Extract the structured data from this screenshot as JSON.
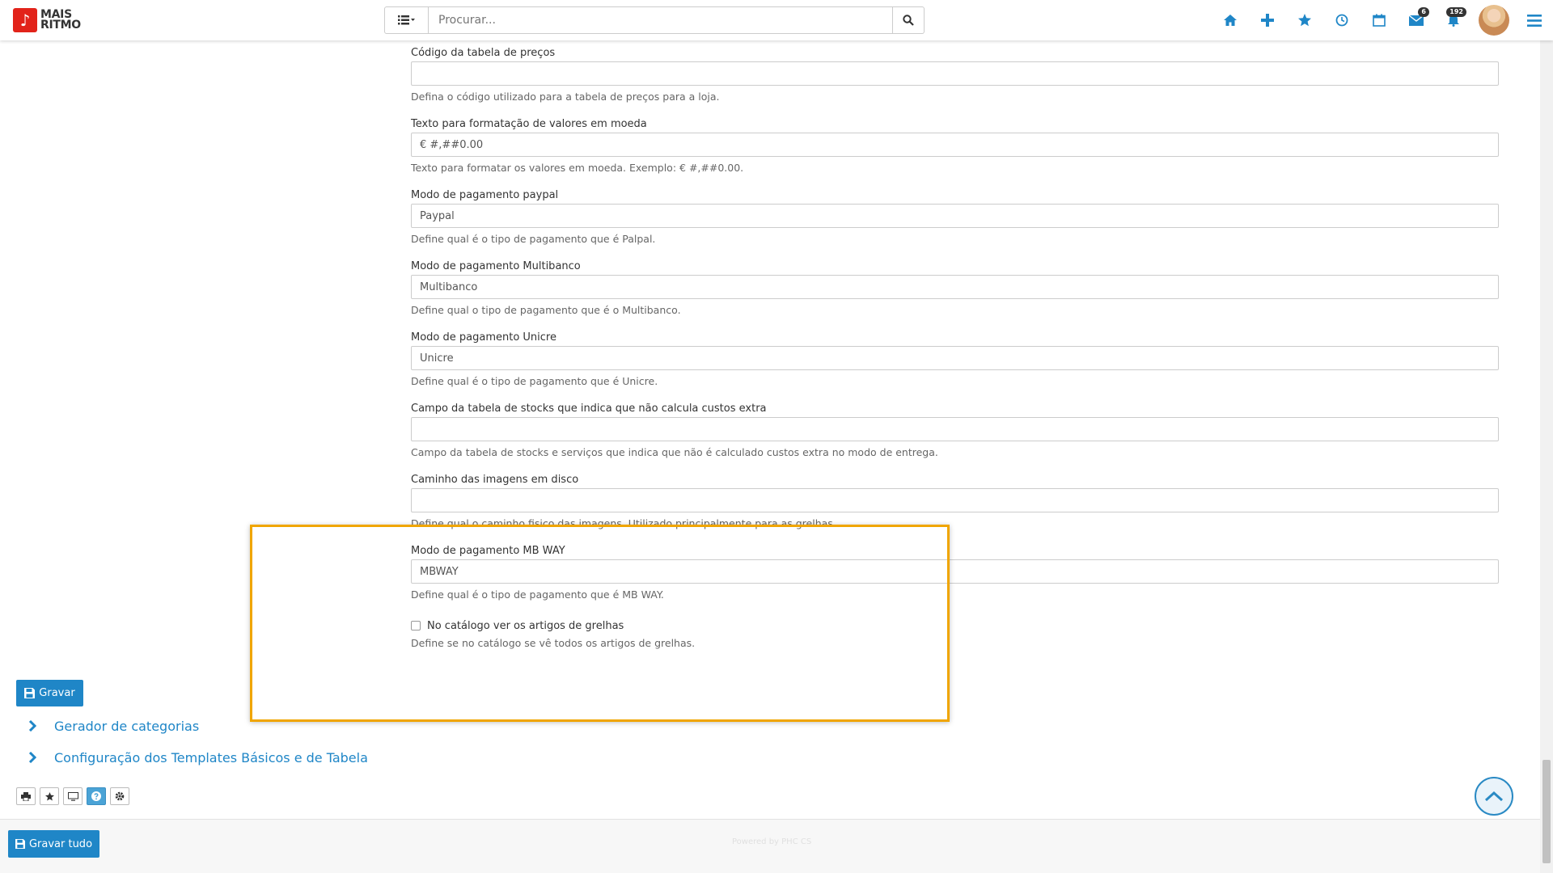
{
  "app": {
    "logo_line1": "MAIS",
    "logo_line2": "RITMO"
  },
  "search": {
    "placeholder": "Procurar..."
  },
  "nav": {
    "mail_badge": "6",
    "notif_badge": "192"
  },
  "form": {
    "fields": [
      {
        "label": "Código da tabela de preços",
        "value": "",
        "help": "Defina o código utilizado para a tabela de preços para a loja."
      },
      {
        "label": "Texto para formatação de valores em moeda",
        "value": "€ #,##0.00",
        "help": "Texto para formatar os valores em moeda. Exemplo: € #,##0.00."
      },
      {
        "label": "Modo de pagamento paypal",
        "value": "Paypal",
        "help": "Define qual é o tipo de pagamento que é Palpal."
      },
      {
        "label": "Modo de pagamento Multibanco",
        "value": "Multibanco",
        "help": "Define qual o tipo de pagamento que é o Multibanco."
      },
      {
        "label": "Modo de pagamento Unicre",
        "value": "Unicre",
        "help": "Define qual é o tipo de pagamento que é Unicre."
      },
      {
        "label": "Campo da tabela de stocks que indica que não calcula custos extra",
        "value": "",
        "help": "Campo da tabela de stocks e serviços que indica que não é calculado custos extra no modo de entrega."
      },
      {
        "label": "Caminho das imagens em disco",
        "value": "",
        "help": "Define qual o caminho fisico das imagens. Utilizado principalmente para as grelhas."
      },
      {
        "label": "Modo de pagamento MB WAY",
        "value": "MBWAY",
        "help": "Define qual é o tipo de pagamento que é MB WAY."
      }
    ],
    "checkbox": {
      "label": "No catálogo ver os artigos de grelhas",
      "help": "Define se no catálogo se vê todos os artigos de grelhas.",
      "checked": false
    }
  },
  "buttons": {
    "save": "Gravar",
    "save_all": "Gravar tudo"
  },
  "sections": [
    {
      "label": "Gerador de categorias"
    },
    {
      "label": "Configuração dos Templates Básicos e de Tabela"
    }
  ],
  "footer": {
    "powered": "Powered by PHC CS"
  },
  "colors": {
    "accent": "#1f86c7",
    "highlight": "#f0a500",
    "brand": "#e2231a"
  }
}
